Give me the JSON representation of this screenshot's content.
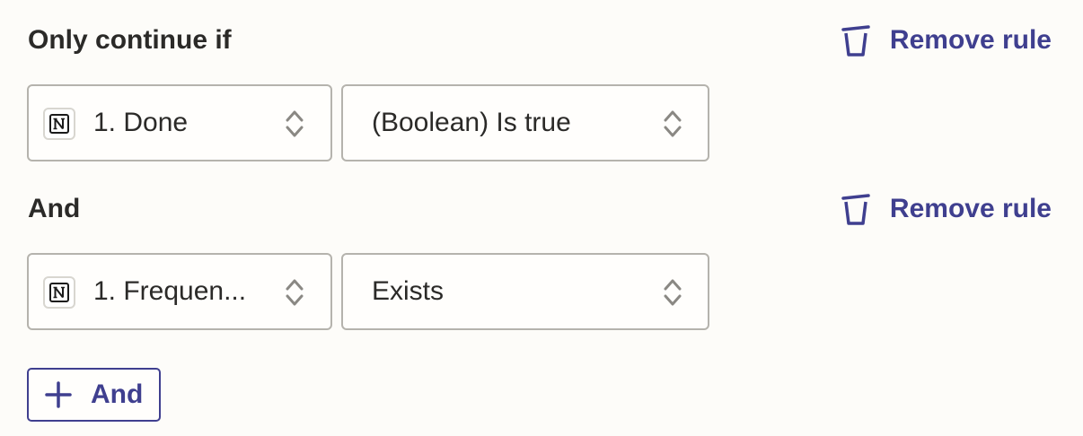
{
  "colors": {
    "background": "#fdfcf9",
    "accent": "#3f3f8f",
    "text": "#2b2a28",
    "border": "#b5b3ad"
  },
  "rules": [
    {
      "title": "Only continue if",
      "remove_label": "Remove rule",
      "remove_icon": "trash-icon",
      "field": {
        "app_icon": "notion-icon",
        "label": "1. Done"
      },
      "condition": {
        "label": "(Boolean) Is true"
      }
    },
    {
      "title": "And",
      "remove_label": "Remove rule",
      "remove_icon": "trash-icon",
      "field": {
        "app_icon": "notion-icon",
        "label": "1. Frequen..."
      },
      "condition": {
        "label": "Exists"
      }
    }
  ],
  "add_button": {
    "icon": "plus-icon",
    "label": "And"
  }
}
